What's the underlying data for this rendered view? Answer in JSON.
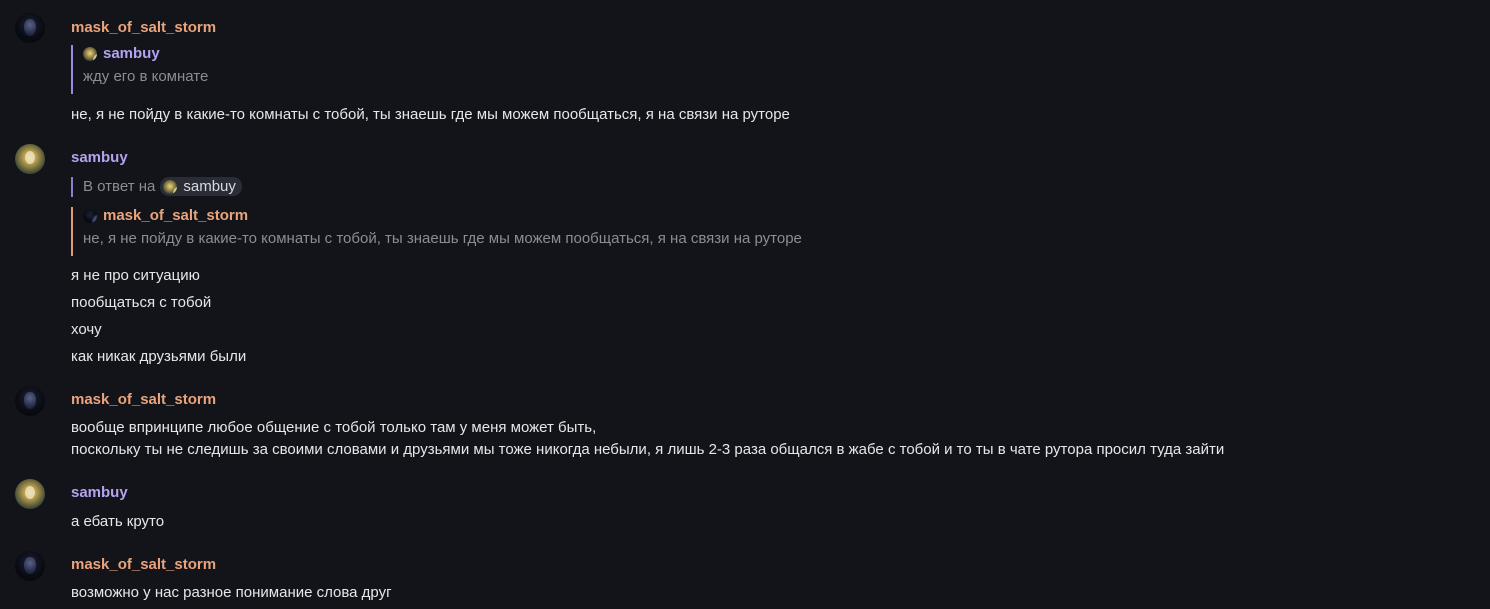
{
  "messages": [
    {
      "author": "mask_of_salt_storm",
      "quote": {
        "author": "sambuy",
        "text": "жду его в комнате"
      },
      "lines": [
        "не, я не пойду в какие-то комнаты с тобой, ты знаешь где мы можем пообщаться, я на связи на руторе"
      ]
    },
    {
      "author": "sambuy",
      "reply_prefix": "В ответ на",
      "reply_to": "sambuy",
      "quote": {
        "author": "mask_of_salt_storm",
        "text": "не, я не пойду в какие-то комнаты с тобой, ты знаешь где мы можем пообщаться, я на связи на руторе"
      },
      "lines": [
        "я не про ситуацию",
        "пообщаться с тобой",
        "хочу",
        "как никак друзьями были"
      ]
    },
    {
      "author": "mask_of_salt_storm",
      "lines": [
        "вообще впринципе любое общение с тобой только там у меня может быть,",
        "поскольку ты не следишь за своими словами и друзьями мы тоже никогда небыли, я лишь 2-3 раза общался в жабе с тобой и то ты в чате рутора просил туда зайти"
      ]
    },
    {
      "author": "sambuy",
      "lines": [
        "а ебать круто"
      ]
    },
    {
      "author": "mask_of_salt_storm",
      "lines": [
        "возможно у нас разное понимание слова друг"
      ]
    }
  ],
  "colors": {
    "background": "#121419",
    "mask_name": "#eaa37a",
    "sambuy_name": "#b3a3f0",
    "muted": "#8a8d96"
  }
}
